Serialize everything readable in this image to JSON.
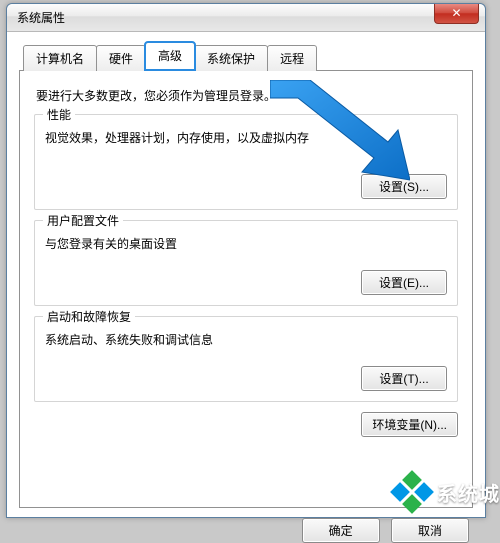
{
  "window": {
    "title": "系统属性"
  },
  "tabs": [
    {
      "label": "计算机名"
    },
    {
      "label": "硬件"
    },
    {
      "label": "高级"
    },
    {
      "label": "系统保护"
    },
    {
      "label": "远程"
    }
  ],
  "intro": "要进行大多数更改，您必须作为管理员登录。",
  "groups": {
    "perf": {
      "legend": "性能",
      "desc": "视觉效果，处理器计划，内存使用，以及虚拟内存",
      "button": "设置(S)..."
    },
    "profile": {
      "legend": "用户配置文件",
      "desc": "与您登录有关的桌面设置",
      "button": "设置(E)..."
    },
    "startup": {
      "legend": "启动和故障恢复",
      "desc": "系统启动、系统失败和调试信息",
      "button": "设置(T)..."
    }
  },
  "env_button": "环境变量(N)...",
  "dlg": {
    "ok": "确定",
    "cancel": "取消"
  },
  "watermark": "系统城",
  "arrow_color": "#1588e8"
}
